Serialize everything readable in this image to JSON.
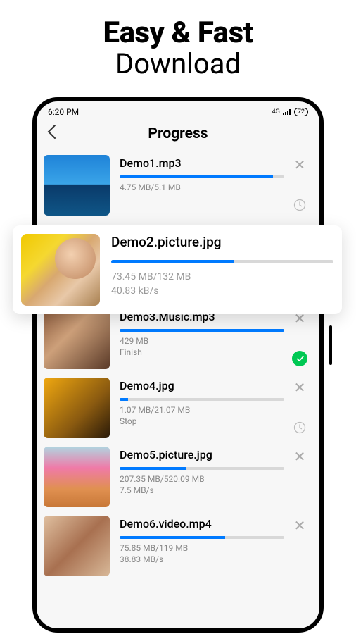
{
  "promo": {
    "line1": "Easy & Fast",
    "line2": "Download"
  },
  "statusbar": {
    "time": "6:20 PM",
    "network": "4G",
    "battery": "72"
  },
  "header": {
    "title": "Progress"
  },
  "elevated": {
    "filename": "Demo2.picture.jpg",
    "size": "73.45 MB/132 MB",
    "speed": "40.83 kB/s",
    "progress_pct": 55
  },
  "items": [
    {
      "filename": "Demo1.mp3",
      "size": "4.75 MB/5.1 MB",
      "speed": "",
      "progress_pct": 93,
      "status": "pending",
      "thumb": "beach"
    },
    {
      "filename": "Demo3.Music.mp3",
      "size": "429 MB",
      "speed": "Finish",
      "progress_pct": 100,
      "status": "done",
      "thumb": "woman1"
    },
    {
      "filename": "Demo4.jpg",
      "size": "1.07 MB/21.07 MB",
      "speed": "Stop",
      "progress_pct": 5,
      "status": "pending",
      "thumb": "baby"
    },
    {
      "filename": "Demo5.picture.jpg",
      "size": "207.35 MB/520.09 MB",
      "speed": "7.5 MB/s",
      "progress_pct": 40,
      "status": "none",
      "thumb": "icecream"
    },
    {
      "filename": "Demo6.video.mp4",
      "size": "75.85 MB/119 MB",
      "speed": "38.83 MB/s",
      "progress_pct": 64,
      "status": "none",
      "thumb": "selfie"
    }
  ]
}
